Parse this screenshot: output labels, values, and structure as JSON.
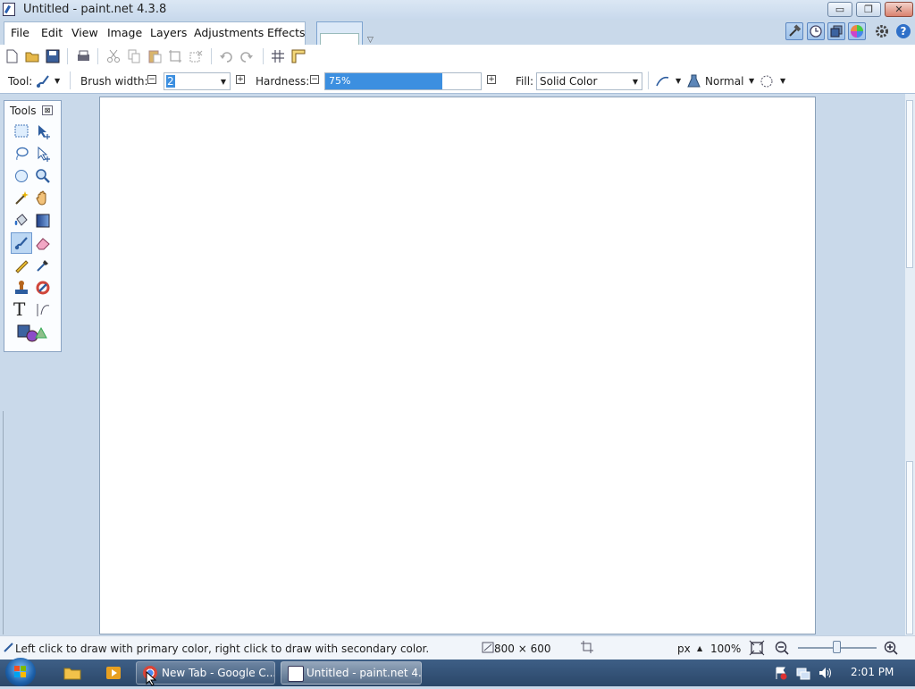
{
  "window": {
    "title": "Untitled - paint.net 4.3.8",
    "minimize_glyph": "▭",
    "restore_glyph": "❐",
    "close_glyph": "✕"
  },
  "menu": {
    "items": [
      "File",
      "Edit",
      "View",
      "Image",
      "Layers",
      "Adjustments",
      "Effects"
    ]
  },
  "toolbar": {
    "tool_label": "Tool:",
    "brush_width_label": "Brush width:",
    "brush_width_value": "2",
    "hardness_label": "Hardness:",
    "hardness_value": "75%",
    "hardness_fraction": 0.75,
    "fill_label": "Fill:",
    "fill_value": "Solid Color",
    "blend_mode": "Normal"
  },
  "tools_panel": {
    "title": "Tools",
    "close_glyph": "⊠",
    "text_tool_glyph": "T",
    "selected_tool": "paintbrush"
  },
  "status": {
    "hint": "Left click to draw with primary color, right click to draw with secondary color.",
    "image_size": "800 × 600",
    "unit": "px",
    "zoom": "100%"
  },
  "taskbar": {
    "items": [
      "New Tab - Google C...",
      "Untitled - paint.net 4..."
    ],
    "clock": "2:01 PM"
  },
  "colors": {
    "accent": "#3c8fe0",
    "canvas": "#ffffff",
    "workspace": "#c9d9ea"
  }
}
